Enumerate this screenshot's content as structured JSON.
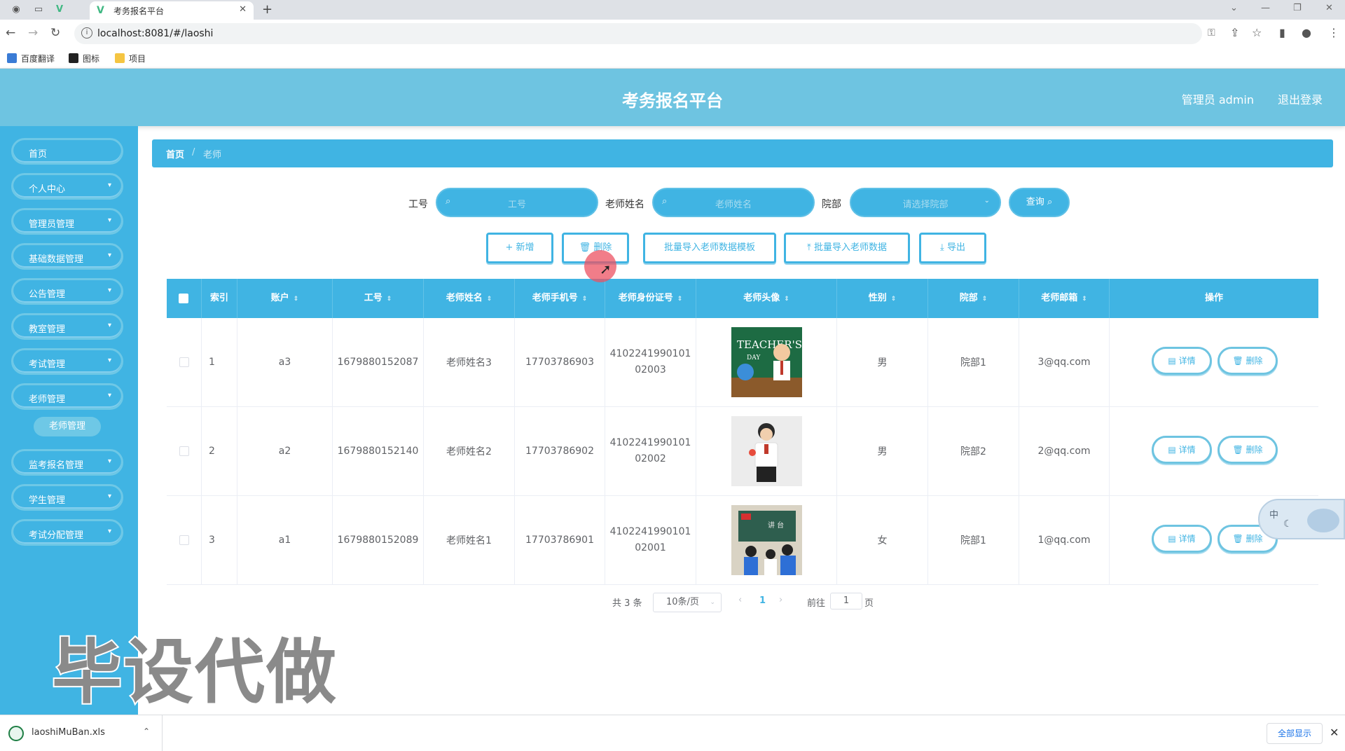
{
  "browser": {
    "tab_title": "考务报名平台",
    "url": "localhost:8081/#/laoshi",
    "bookmarks": [
      "百度翻译",
      "图标",
      "项目"
    ]
  },
  "header": {
    "title": "考务报名平台",
    "user_label": "管理员 admin",
    "logout_label": "退出登录"
  },
  "sidebar": {
    "items": [
      {
        "label": "首页"
      },
      {
        "label": "个人中心"
      },
      {
        "label": "管理员管理"
      },
      {
        "label": "基础数据管理"
      },
      {
        "label": "公告管理"
      },
      {
        "label": "教室管理"
      },
      {
        "label": "考试管理"
      },
      {
        "label": "老师管理"
      },
      {
        "label": "监考报名管理"
      },
      {
        "label": "学生管理"
      },
      {
        "label": "考试分配管理"
      }
    ],
    "active_sub": "老师管理"
  },
  "breadcrumb": {
    "home": "首页",
    "sep": "/",
    "current": "老师"
  },
  "search": {
    "gonghao_label": "工号",
    "gonghao_placeholder": "工号",
    "name_label": "老师姓名",
    "name_placeholder": "老师姓名",
    "dept_label": "院部",
    "dept_placeholder": "请选择院部",
    "query_label": "查询"
  },
  "actions": {
    "add": "+ 新增",
    "delete": "删除",
    "template": "批量导入老师数据模板",
    "import": "批量导入老师数据",
    "export": "导出"
  },
  "table": {
    "headers": [
      "索引",
      "账户",
      "工号",
      "老师姓名",
      "老师手机号",
      "老师身份证号",
      "老师头像",
      "性别",
      "院部",
      "老师邮箱",
      "操作"
    ],
    "rows": [
      {
        "index": "1",
        "account": "a3",
        "gonghao": "1679880152087",
        "name": "老师姓名3",
        "phone": "17703786903",
        "idcard1": "4102241990101",
        "idcard2": "02003",
        "gender": "男",
        "dept": "院部1",
        "email": "3@qq.com"
      },
      {
        "index": "2",
        "account": "a2",
        "gonghao": "1679880152140",
        "name": "老师姓名2",
        "phone": "17703786902",
        "idcard1": "4102241990101",
        "idcard2": "02002",
        "gender": "男",
        "dept": "院部2",
        "email": "2@qq.com"
      },
      {
        "index": "3",
        "account": "a1",
        "gonghao": "1679880152089",
        "name": "老师姓名1",
        "phone": "17703786901",
        "idcard1": "4102241990101",
        "idcard2": "02001",
        "gender": "女",
        "dept": "院部1",
        "email": "1@qq.com"
      }
    ],
    "detail_label": "详情",
    "delete_label": "删除"
  },
  "pagination": {
    "total": "共 3 条",
    "page_size": "10条/页",
    "current": "1",
    "goto_label": "前往",
    "goto_value": "1",
    "page_suffix": "页"
  },
  "watermark": "毕设代做",
  "ime": {
    "mode": "中"
  },
  "download": {
    "filename": "laoshiMuBan.xls",
    "show_all": "全部显示"
  }
}
